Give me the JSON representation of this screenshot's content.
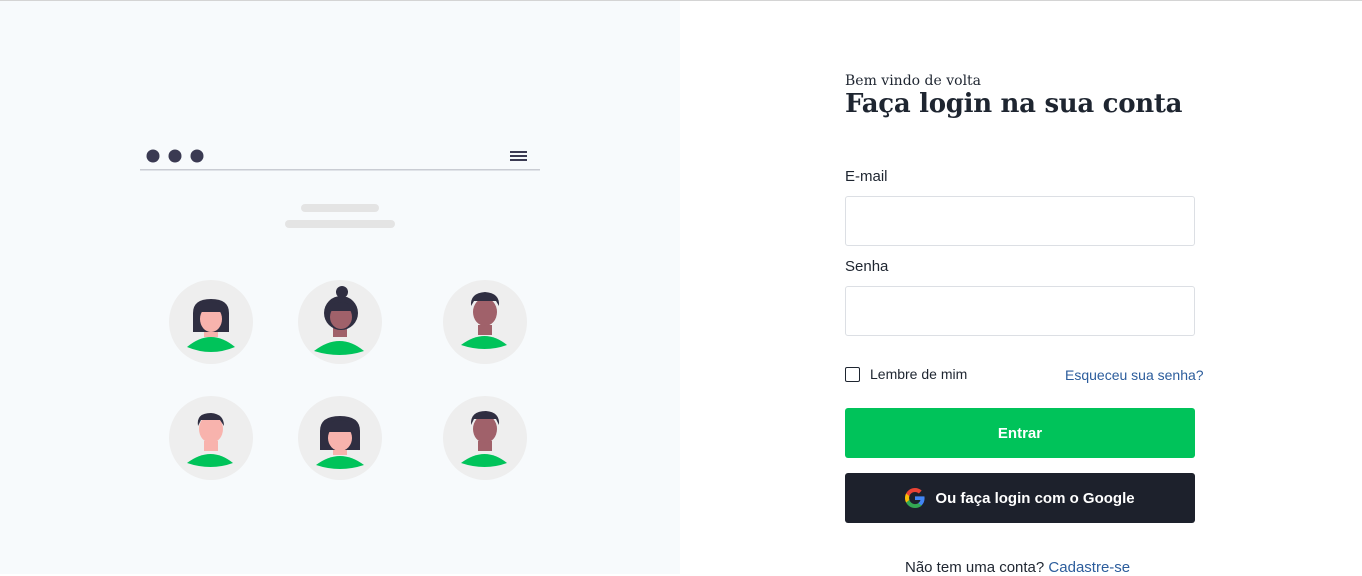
{
  "login": {
    "welcome": "Bem vindo de volta",
    "title": "Faça login na sua conta",
    "email_label": "E-mail",
    "email_value": "",
    "email_placeholder": "",
    "password_label": "Senha",
    "password_value": "",
    "password_placeholder": "",
    "remember_label": "Lembre de mim",
    "remember_checked": false,
    "forgot_link": "Esqueceu sua senha?",
    "submit_label": "Entrar",
    "google_label": "Ou faça login com o Google",
    "signup_prompt": "Não tem uma conta?",
    "signup_link": "Cadastre-se"
  },
  "illustration": {
    "icons": [
      "window-dots-icon",
      "menu-icon",
      "avatar-icon"
    ]
  },
  "colors": {
    "accent_green": "#00c35a",
    "dark_button": "#1d212c",
    "link_blue": "#2c5d9c",
    "text_dark": "#1e2530",
    "left_bg": "#f7fafc"
  }
}
